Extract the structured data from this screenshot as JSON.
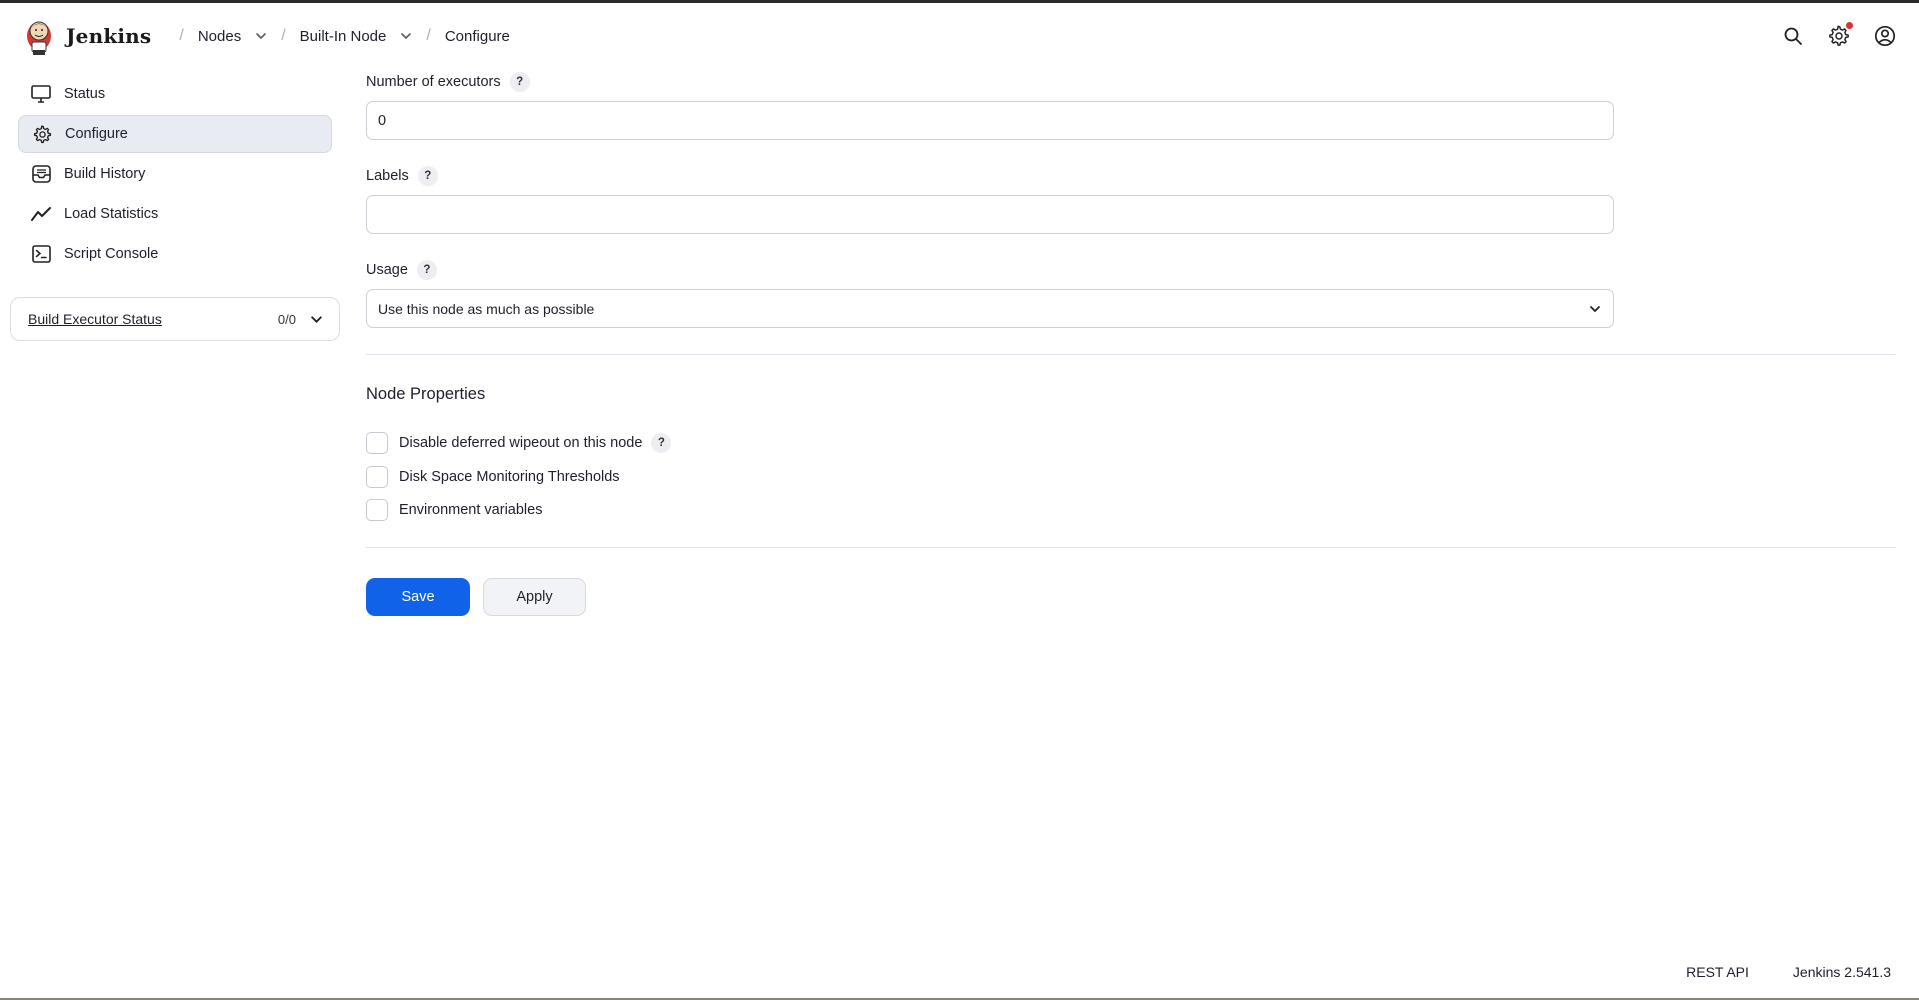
{
  "header": {
    "brand": "Jenkins",
    "breadcrumbs": [
      {
        "label": "Nodes",
        "has_menu": true
      },
      {
        "label": "Built-In Node",
        "has_menu": true
      },
      {
        "label": "Configure",
        "has_menu": false
      }
    ],
    "actions": [
      "search-icon",
      "gear-icon",
      "user-icon"
    ],
    "notification_color": "#e0302d"
  },
  "sidebar": {
    "items": [
      {
        "label": "Status",
        "icon": "monitor-icon",
        "active": false
      },
      {
        "label": "Configure",
        "icon": "gear-icon",
        "active": true
      },
      {
        "label": "Build History",
        "icon": "inbox-icon",
        "active": false
      },
      {
        "label": "Load Statistics",
        "icon": "chart-line-icon",
        "active": false
      },
      {
        "label": "Script Console",
        "icon": "terminal-icon",
        "active": false
      }
    ],
    "executor_status": {
      "title": "Build Executor Status",
      "count": "0/0"
    }
  },
  "form": {
    "executors": {
      "label": "Number of executors",
      "help": "?",
      "value": "0"
    },
    "labels": {
      "label": "Labels",
      "help": "?",
      "value": ""
    },
    "usage": {
      "label": "Usage",
      "help": "?",
      "value": "Use this node as much as possible"
    },
    "node_properties": {
      "title": "Node Properties",
      "options": [
        {
          "label": "Disable deferred wipeout on this node",
          "help": "?",
          "checked": false
        },
        {
          "label": "Disk Space Monitoring Thresholds",
          "checked": false
        },
        {
          "label": "Environment variables",
          "checked": false
        }
      ]
    },
    "save_label": "Save",
    "apply_label": "Apply"
  },
  "footer": {
    "rest_api": "REST API",
    "version": "Jenkins 2.541.3"
  },
  "colors": {
    "primary": "#1063e8",
    "active_bg": "#e8ebf2"
  }
}
